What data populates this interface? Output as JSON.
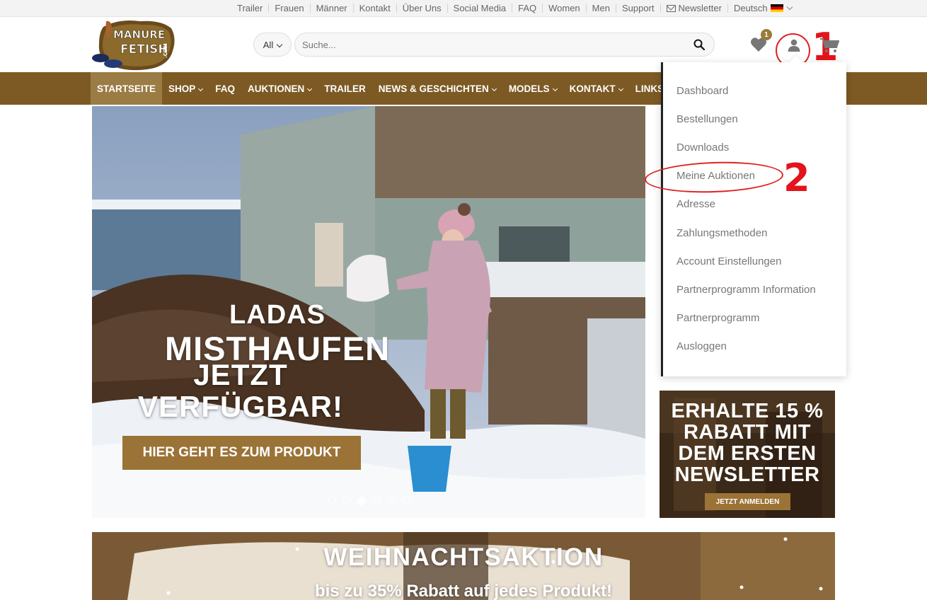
{
  "topbar": {
    "links": [
      "Trailer",
      "Frauen",
      "Männer",
      "Kontakt",
      "Über Uns",
      "Social Media",
      "FAQ",
      "Women",
      "Men",
      "Support"
    ],
    "newsletter": "Newsletter",
    "language": "Deutsch"
  },
  "header": {
    "logo_text": "MANURE FETISH .COM",
    "category_select": "All",
    "search_placeholder": "Suche...",
    "wishlist_count": "1"
  },
  "nav": {
    "items": [
      "STARTSEITE",
      "SHOP",
      "FAQ",
      "AUKTIONEN",
      "TRAILER",
      "NEWS & GESCHICHTEN",
      "MODELS",
      "KONTAKT",
      "LINKS"
    ]
  },
  "hero": {
    "title_line1": "LADAS",
    "title_line2": "MISTHAUFEN",
    "sub_line1": "JETZT",
    "sub_line2": "VERFÜGBAR!",
    "button": "HIER GEHT ES ZUM PRODUKT",
    "slide_count": 6,
    "active_slide": 3
  },
  "account_menu": {
    "items": [
      "Dashboard",
      "Bestellungen",
      "Downloads",
      "Meine Auktionen",
      "Adresse",
      "Zahlungsmethoden",
      "Account Einstellungen",
      "Partnerprogramm Information",
      "Partnerprogramm",
      "Ausloggen"
    ]
  },
  "annotations": {
    "marker1": "1",
    "marker2": "2"
  },
  "promo": {
    "lines": [
      "ERHALTE 15 %",
      "RABATT MIT",
      "DEM ERSTEN",
      "NEWSLETTER"
    ],
    "button": "JETZT ANMELDEN"
  },
  "xmas": {
    "title": "WEIHNACHTSAKTION",
    "subtitle": "bis zu 35% Rabatt auf jedes Produkt!"
  },
  "colors": {
    "nav_bg": "#7d5a24",
    "accent": "#9b7336",
    "annotation": "#e3141b"
  }
}
